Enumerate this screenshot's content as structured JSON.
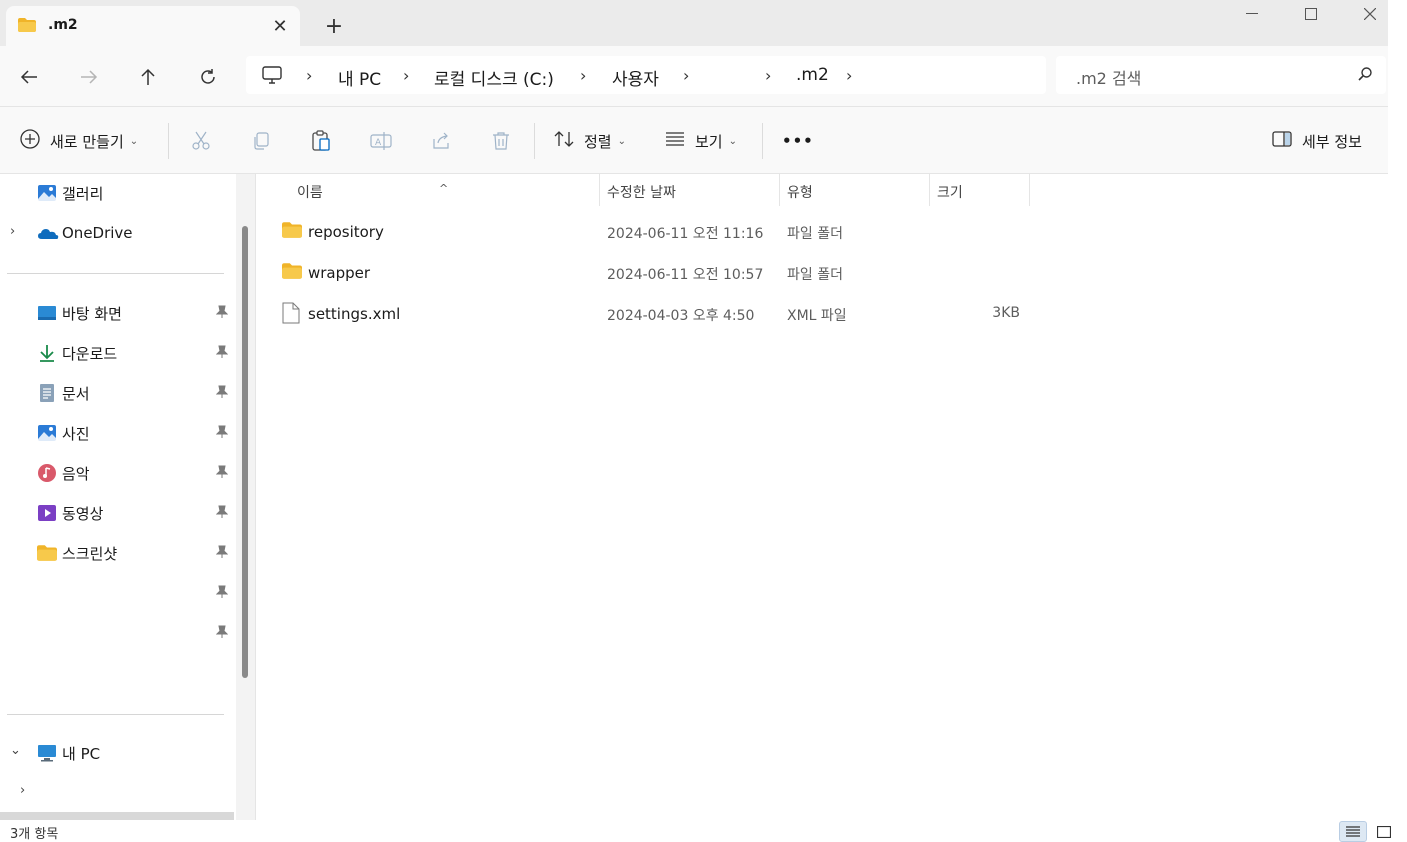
{
  "window": {
    "tab_title": ".m2",
    "new_tab_label": "+"
  },
  "address": {
    "crumbs": [
      "내 PC",
      "로컬 디스크 (C:)",
      "사용자",
      "",
      ".m2"
    ],
    "search_placeholder": ".m2 검색"
  },
  "commands": {
    "new_label": "새로 만들기",
    "sort_label": "정렬",
    "view_label": "보기",
    "more_label": "•••",
    "details_label": "세부 정보"
  },
  "sidebar": {
    "top_items": [
      {
        "label": "갤러리",
        "icon": "gallery-icon"
      },
      {
        "label": "OneDrive",
        "icon": "onedrive-icon"
      }
    ],
    "quick_access": [
      {
        "label": "바탕 화면",
        "icon": "desktop-icon"
      },
      {
        "label": "다운로드",
        "icon": "download-icon"
      },
      {
        "label": "문서",
        "icon": "document-icon"
      },
      {
        "label": "사진",
        "icon": "pictures-icon"
      },
      {
        "label": "음악",
        "icon": "music-icon"
      },
      {
        "label": "동영상",
        "icon": "videos-icon"
      },
      {
        "label": "스크린샷",
        "icon": "folder-icon"
      },
      {
        "label": "",
        "icon": ""
      },
      {
        "label": "",
        "icon": ""
      }
    ],
    "this_pc": {
      "label": "내 PC",
      "icon": "pc-icon"
    }
  },
  "columns": {
    "name": "이름",
    "date": "수정한 날짜",
    "type": "유형",
    "size": "크기"
  },
  "files": [
    {
      "name": "repository",
      "date": "2024-06-11 오전 11:16",
      "type": "파일 폴더",
      "size": "",
      "icon": "folder-icon"
    },
    {
      "name": "wrapper",
      "date": "2024-06-11 오전 10:57",
      "type": "파일 폴더",
      "size": "",
      "icon": "folder-icon"
    },
    {
      "name": "settings.xml",
      "date": "2024-04-03 오후 4:50",
      "type": "XML 파일",
      "size": "3KB",
      "icon": "file-icon"
    }
  ],
  "status": {
    "item_count": "3개 항목"
  },
  "colors": {
    "folder": "#f7c94b",
    "accent": "#0067c0"
  }
}
